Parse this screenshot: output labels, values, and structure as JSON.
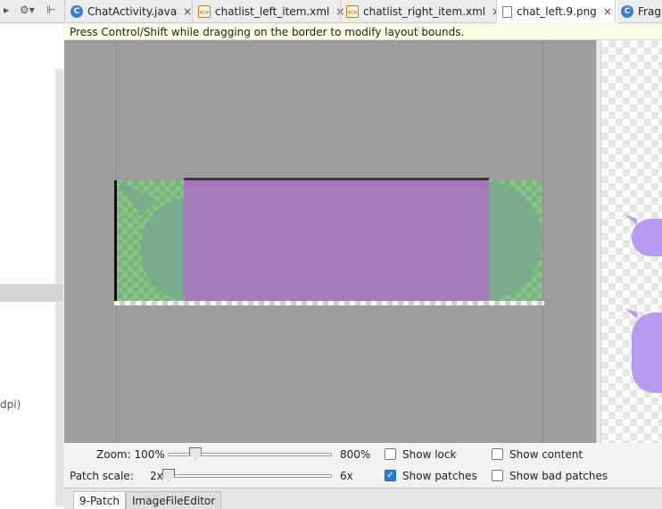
{
  "tabs": [
    {
      "label": "ChatActivity.java",
      "icon": "java-class-icon",
      "active": false
    },
    {
      "label": "chatlist_left_item.xml",
      "icon": "xml-file-icon",
      "active": false
    },
    {
      "label": "chatlist_right_item.xml",
      "icon": "xml-file-icon",
      "active": false
    },
    {
      "label": "chat_left.9.png",
      "icon": "image-file-icon",
      "active": true
    },
    {
      "label": "Frag",
      "icon": "java-class-icon",
      "active": false
    }
  ],
  "tab_close_glyph": "×",
  "toolbar": {
    "gear_glyph": "⚙▾",
    "collapse_glyph": "⊩"
  },
  "left_panel": {
    "dpi_text": "dpi)"
  },
  "hint": "Press Control/Shift while dragging on the border to modify layout bounds.",
  "controls": {
    "zoom_label": "Zoom: 100%",
    "zoom_max": "800%",
    "zoom_fraction": 0.14,
    "patch_scale_label": "Patch scale:",
    "patch_scale_min": "2x",
    "patch_scale_max": "6x",
    "patch_scale_fraction": 0.0,
    "show_lock": {
      "label": "Show lock",
      "checked": false
    },
    "show_content": {
      "label": "Show content",
      "checked": false
    },
    "show_patches": {
      "label": "Show patches",
      "checked": true
    },
    "show_bad_patches": {
      "label": "Show bad patches",
      "checked": false
    }
  },
  "bottom_tabs": [
    {
      "label": "9-Patch",
      "active": true
    },
    {
      "label": "ImageFileEditor",
      "active": false
    }
  ],
  "colors": {
    "patch_purple": "#a67ab8",
    "patch_green": "#8dc28d",
    "canvas_gray": "#9d9d9d",
    "preview_bubble": "#b89cf3",
    "checkbox_checked": "#2d7fd6"
  }
}
